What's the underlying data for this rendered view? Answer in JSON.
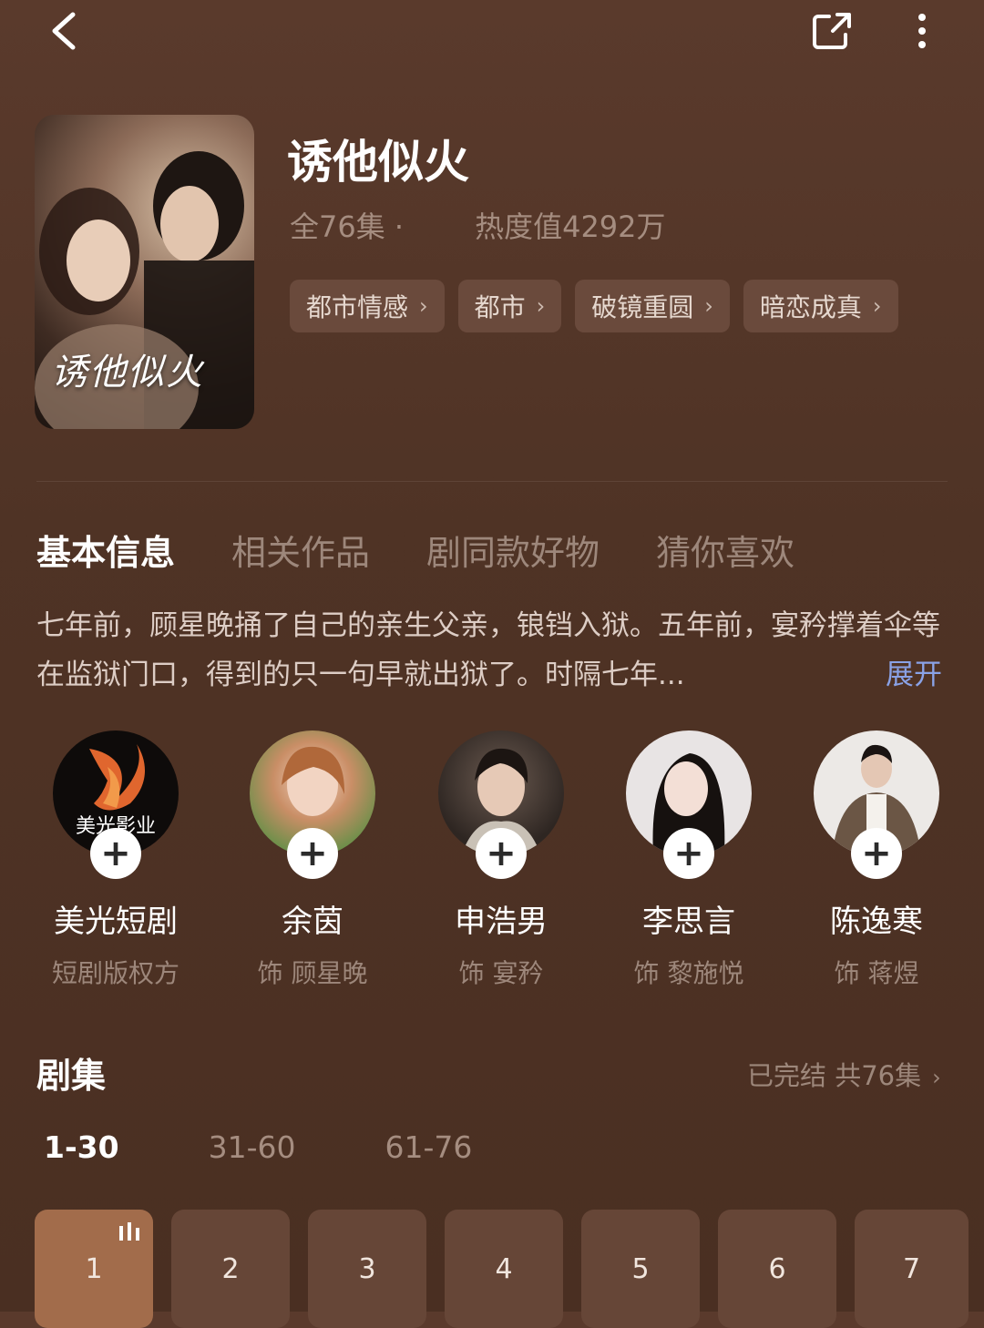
{
  "header": {
    "back_icon": "chevron-left-icon",
    "share_icon": "share-icon",
    "more_icon": "more-vertical-icon"
  },
  "drama": {
    "poster_title": "诱他似火",
    "title": "诱他似火",
    "episode_count": "全76集 ·",
    "heat": "热度值4292万",
    "tags": [
      "都市情感",
      "都市",
      "破镜重圆",
      "暗恋成真"
    ]
  },
  "tabs": [
    "基本信息",
    "相关作品",
    "剧同款好物",
    "猜你喜欢"
  ],
  "synopsis": {
    "text": "七年前，顾星晚捅了自己的亲生父亲，锒铛入狱。五年前，宴矜撑着伞等在监狱门口，得到的只一句早就出狱了。时隔七年...",
    "expand_label": "展开"
  },
  "cast": [
    {
      "name": "美光短剧",
      "role": "短剧版权方",
      "logo_text": "美光影业"
    },
    {
      "name": "余茵",
      "role": "饰 顾星晚"
    },
    {
      "name": "申浩男",
      "role": "饰 宴矜"
    },
    {
      "name": "李思言",
      "role": "饰 黎施悦"
    },
    {
      "name": "陈逸寒",
      "role": "饰 蒋煜"
    }
  ],
  "episodes_section": {
    "title": "剧集",
    "status": "已完结 共76集",
    "ranges": [
      "1-30",
      "31-60",
      "61-76"
    ],
    "active_range": "1-30",
    "episodes": [
      "1",
      "2",
      "3",
      "4",
      "5",
      "6",
      "7"
    ],
    "active_episode": "1"
  },
  "colors": {
    "background": "#4f3325",
    "accent": "#a26c4b",
    "link": "#8aa2e6"
  }
}
